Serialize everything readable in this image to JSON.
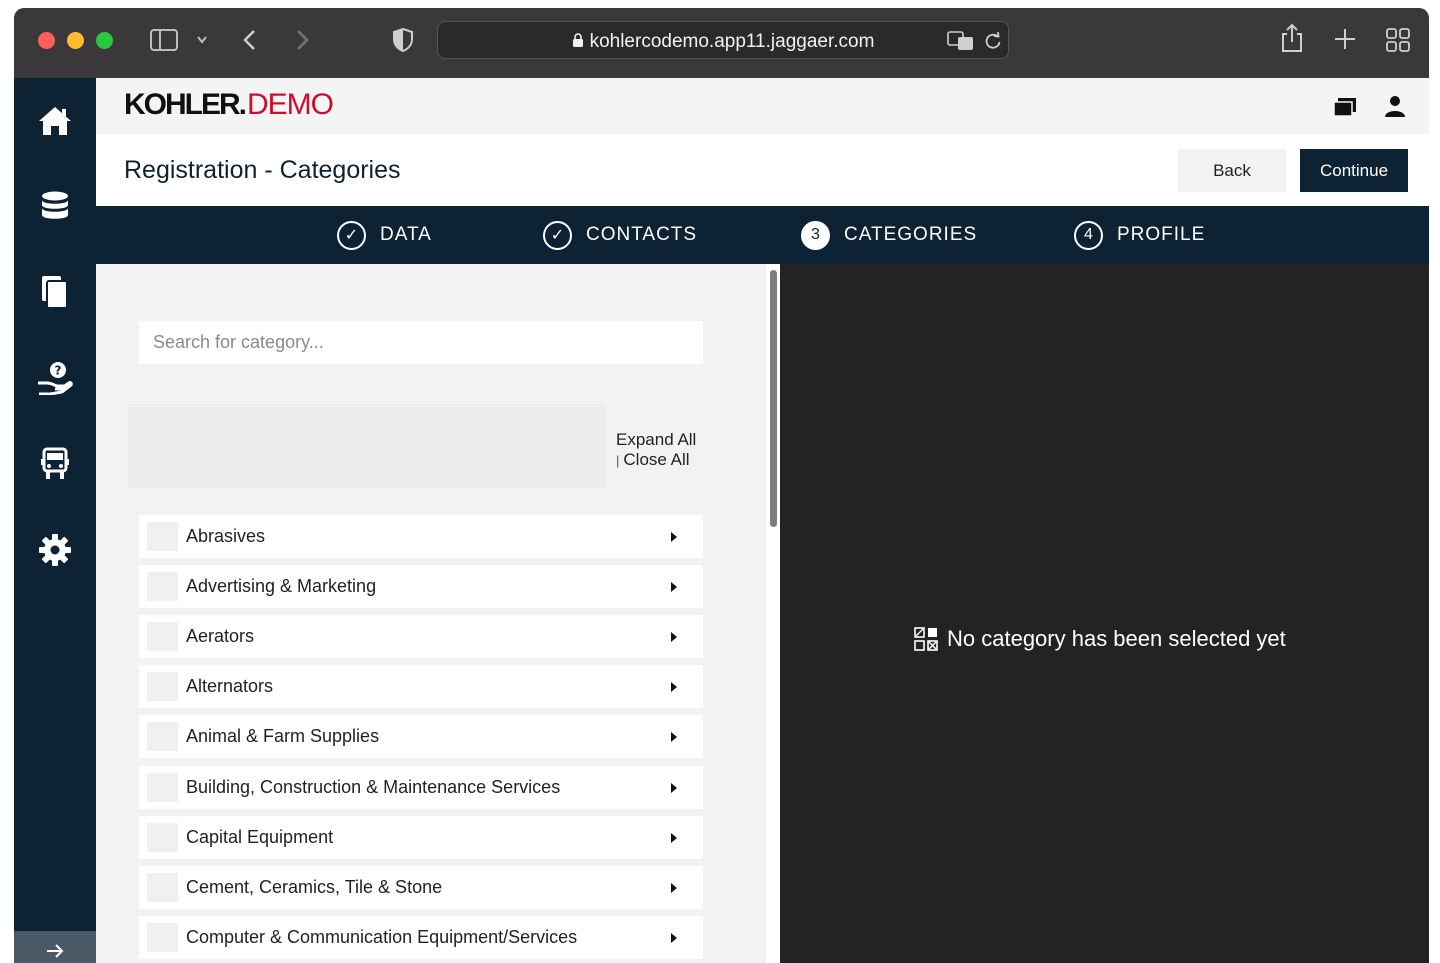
{
  "browser": {
    "url": "kohlercodemo.app11.jaggaer.com"
  },
  "header": {
    "logo_brand": "KOHLER.",
    "logo_suffix": "DEMO"
  },
  "page": {
    "title": "Registration - Categories",
    "back_label": "Back",
    "continue_label": "Continue"
  },
  "stepper": {
    "steps": [
      {
        "label": "DATA",
        "marker": "✓",
        "state": "done"
      },
      {
        "label": "CONTACTS",
        "marker": "✓",
        "state": "done"
      },
      {
        "label": "CATEGORIES",
        "marker": "3",
        "state": "active"
      },
      {
        "label": "PROFILE",
        "marker": "4",
        "state": "pending"
      }
    ]
  },
  "categories": {
    "search_placeholder": "Search for category...",
    "expand_all": "Expand All",
    "close_all": "Close All",
    "items": [
      {
        "label": "Abrasives"
      },
      {
        "label": "Advertising & Marketing"
      },
      {
        "label": "Aerators"
      },
      {
        "label": "Alternators"
      },
      {
        "label": "Animal & Farm Supplies"
      },
      {
        "label": "Building, Construction & Maintenance Services"
      },
      {
        "label": "Capital Equipment"
      },
      {
        "label": "Cement, Ceramics, Tile & Stone"
      },
      {
        "label": "Computer & Communication Equipment/Services"
      }
    ]
  },
  "selection": {
    "empty_message": "No category has been selected yet"
  },
  "colors": {
    "navy": "#0d2233",
    "brand_red": "#c8102e",
    "panel_dark": "#232323"
  }
}
